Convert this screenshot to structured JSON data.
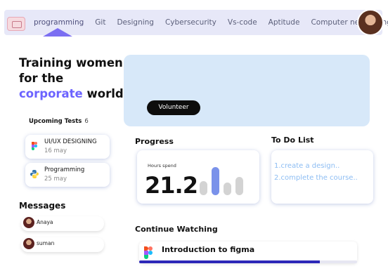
{
  "nav": {
    "items": [
      "programming",
      "Git",
      "Designing",
      "Cybersecurity",
      "Vs-code",
      "Aptitude",
      "Computer networking"
    ],
    "active_index": 0
  },
  "hero": {
    "title_part1": "Training women for the ",
    "title_accent": "corporate",
    "title_part2": " world",
    "accent_color": "#6c63ff",
    "cta_label": "Volunteer"
  },
  "upcoming_tests": {
    "title": "Upcoming Tests",
    "count": "6",
    "items": [
      {
        "name": "UI/UX DESIGNING",
        "date": "16 may",
        "icon": "figma-icon"
      },
      {
        "name": "Programming",
        "date": "25 may",
        "icon": "python-icon"
      }
    ]
  },
  "messages": {
    "title": "Messages",
    "items": [
      {
        "name": "Anaya"
      },
      {
        "name": "suman"
      }
    ]
  },
  "progress": {
    "title": "Progress",
    "hours_label": "Hours spend",
    "hours_value": "21.2",
    "bar_levels": [
      0.5,
      1.0,
      0.45,
      0.65
    ],
    "highlight_color": "#7a92ea"
  },
  "todo": {
    "title": "To Do List",
    "items": [
      "1.create a design..",
      "2.complete the course.."
    ]
  },
  "continue_watching": {
    "title": "Continue Watching",
    "course_name": "Introduction to figma",
    "progress_fraction": 0.83
  }
}
